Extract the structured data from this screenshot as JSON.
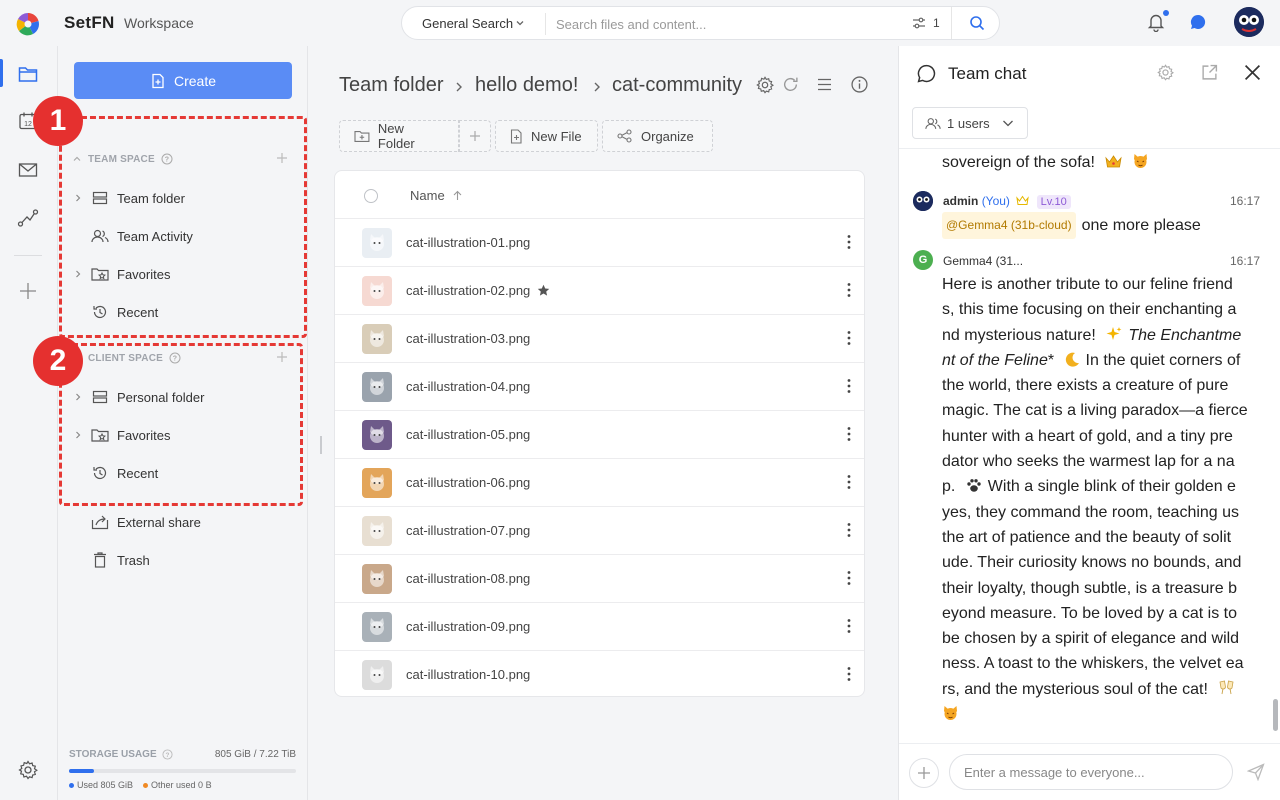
{
  "app": {
    "brand": "SetFN",
    "workspace": "Workspace"
  },
  "search": {
    "scope": "General Search",
    "placeholder": "Search files and content...",
    "filter_count": "1"
  },
  "sidebar": {
    "create_label": "Create",
    "team_space": {
      "heading": "TEAM SPACE",
      "items": [
        {
          "label": "Team folder",
          "icon": "server-icon",
          "expandable": true
        },
        {
          "label": "Team Activity",
          "icon": "people-icon",
          "expandable": false
        },
        {
          "label": "Favorites",
          "icon": "folder-star-icon",
          "expandable": true
        },
        {
          "label": "Recent",
          "icon": "history-icon",
          "expandable": false
        }
      ]
    },
    "client_space": {
      "heading": "CLIENT SPACE",
      "items": [
        {
          "label": "Personal folder",
          "icon": "server-icon",
          "expandable": true
        },
        {
          "label": "Favorites",
          "icon": "folder-star-icon",
          "expandable": true
        },
        {
          "label": "Recent",
          "icon": "history-icon",
          "expandable": false
        }
      ]
    },
    "extra": [
      {
        "label": "External share",
        "icon": "share-icon"
      },
      {
        "label": "Trash",
        "icon": "trash-icon"
      }
    ],
    "annotations": [
      "1",
      "2"
    ],
    "storage": {
      "label": "STORAGE USAGE",
      "value": "805 GiB / 7.22 TiB",
      "used_fraction": 0.11,
      "used_label": "Used 805 GiB",
      "other_label": "Other used 0 B"
    }
  },
  "breadcrumb": [
    "Team folder",
    "hello demo!",
    "cat-community"
  ],
  "toolbar": {
    "new_folder": "New Folder",
    "new_file": "New File",
    "organize": "Organize"
  },
  "files": {
    "name_header": "Name",
    "rows": [
      {
        "name": "cat-illustration-01.png",
        "starred": false,
        "thumb_color": "#e9eef3"
      },
      {
        "name": "cat-illustration-02.png",
        "starred": true,
        "thumb_color": "#f6d9d2"
      },
      {
        "name": "cat-illustration-03.png",
        "starred": false,
        "thumb_color": "#d9cdb8"
      },
      {
        "name": "cat-illustration-04.png",
        "starred": false,
        "thumb_color": "#9aa3ad"
      },
      {
        "name": "cat-illustration-05.png",
        "starred": false,
        "thumb_color": "#6e5a8a"
      },
      {
        "name": "cat-illustration-06.png",
        "starred": false,
        "thumb_color": "#e3a55a"
      },
      {
        "name": "cat-illustration-07.png",
        "starred": false,
        "thumb_color": "#e8dfd2"
      },
      {
        "name": "cat-illustration-08.png",
        "starred": false,
        "thumb_color": "#c9a88a"
      },
      {
        "name": "cat-illustration-09.png",
        "starred": false,
        "thumb_color": "#a9b1b8"
      },
      {
        "name": "cat-illustration-10.png",
        "starred": false,
        "thumb_color": "#dcdcdc"
      }
    ]
  },
  "chat": {
    "title": "Team chat",
    "users": "1 users",
    "prev_tail": "sovereign of the sofa!",
    "messages": [
      {
        "author": "admin",
        "you": "(You)",
        "level": "Lv.10",
        "time": "16:17",
        "mention": "@Gemma4 (31b-cloud)",
        "text": "one more please"
      },
      {
        "author": "Gemma4 (31...",
        "avatar_letter": "G",
        "time": "16:17",
        "lines": [
          "Here is another tribute to our feline friend",
          "s, this time focusing on their enchanting a",
          "nd mysterious nature!",
          "The Enchantme",
          "nt of the Feline",
          "*",
          "In the quiet corners of",
          "the world, there exists a creature of pure",
          "magic. The cat is a living paradox—a fierce",
          "hunter with a heart of gold, and a tiny pre",
          "dator who seeks the warmest lap for a na",
          "p.",
          "With a single blink of their golden e",
          "yes, they command the room, teaching us",
          "the art of patience and the beauty of solit",
          "ude. Their curiosity knows no bounds, and",
          "their loyalty, though subtle, is a treasure b",
          "eyond measure. To be loved by a cat is to",
          "be chosen by a spirit of elegance and wild",
          "ness. A toast to the whiskers, the velvet ea",
          "rs, and the mysterious soul of the cat!"
        ]
      }
    ],
    "input_placeholder": "Enter a message to everyone..."
  },
  "colors": {
    "accent": "#2f6fed",
    "create": "#5a8cf5",
    "annotation": "#e5302f"
  }
}
